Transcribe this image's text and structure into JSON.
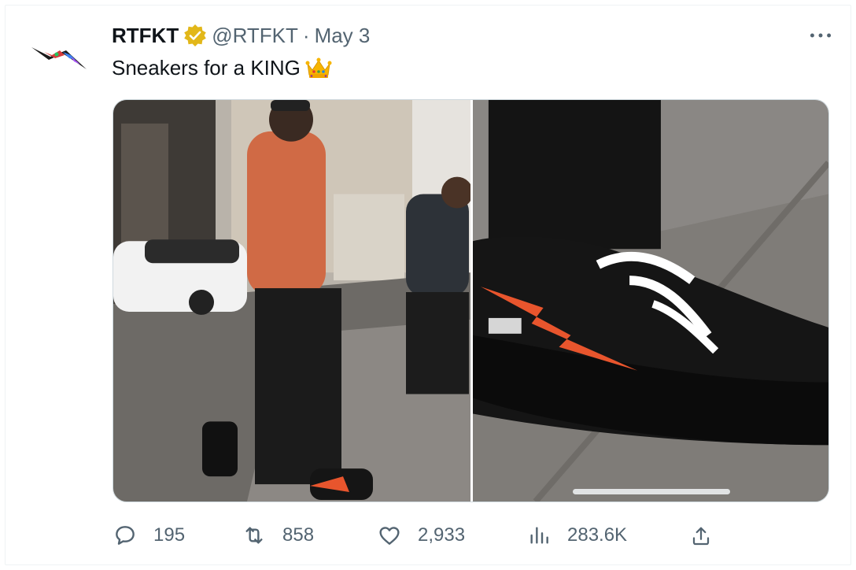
{
  "tweet": {
    "author_name": "RTFKT",
    "handle": "@RTFKT",
    "separator": "·",
    "date": "May 3",
    "text": "Sneakers for a KING",
    "emoji": "crown-emoji",
    "verified_color": "#e2b719",
    "more_icon": "more-horizontal-icon"
  },
  "media": {
    "count": 2,
    "items": [
      {
        "icon": "photo",
        "subject": "person-walking-street"
      },
      {
        "icon": "photo",
        "subject": "sneaker-closeup"
      }
    ]
  },
  "actions": {
    "reply": {
      "icon": "reply-icon",
      "count": "195"
    },
    "retweet": {
      "icon": "retweet-icon",
      "count": "858"
    },
    "like": {
      "icon": "heart-icon",
      "count": "2,933"
    },
    "views": {
      "icon": "views-icon",
      "count": "283.6K"
    },
    "share": {
      "icon": "share-icon"
    }
  },
  "colors": {
    "text_primary": "#0f1419",
    "text_secondary": "#536471",
    "accent_orange": "#e8552d"
  }
}
